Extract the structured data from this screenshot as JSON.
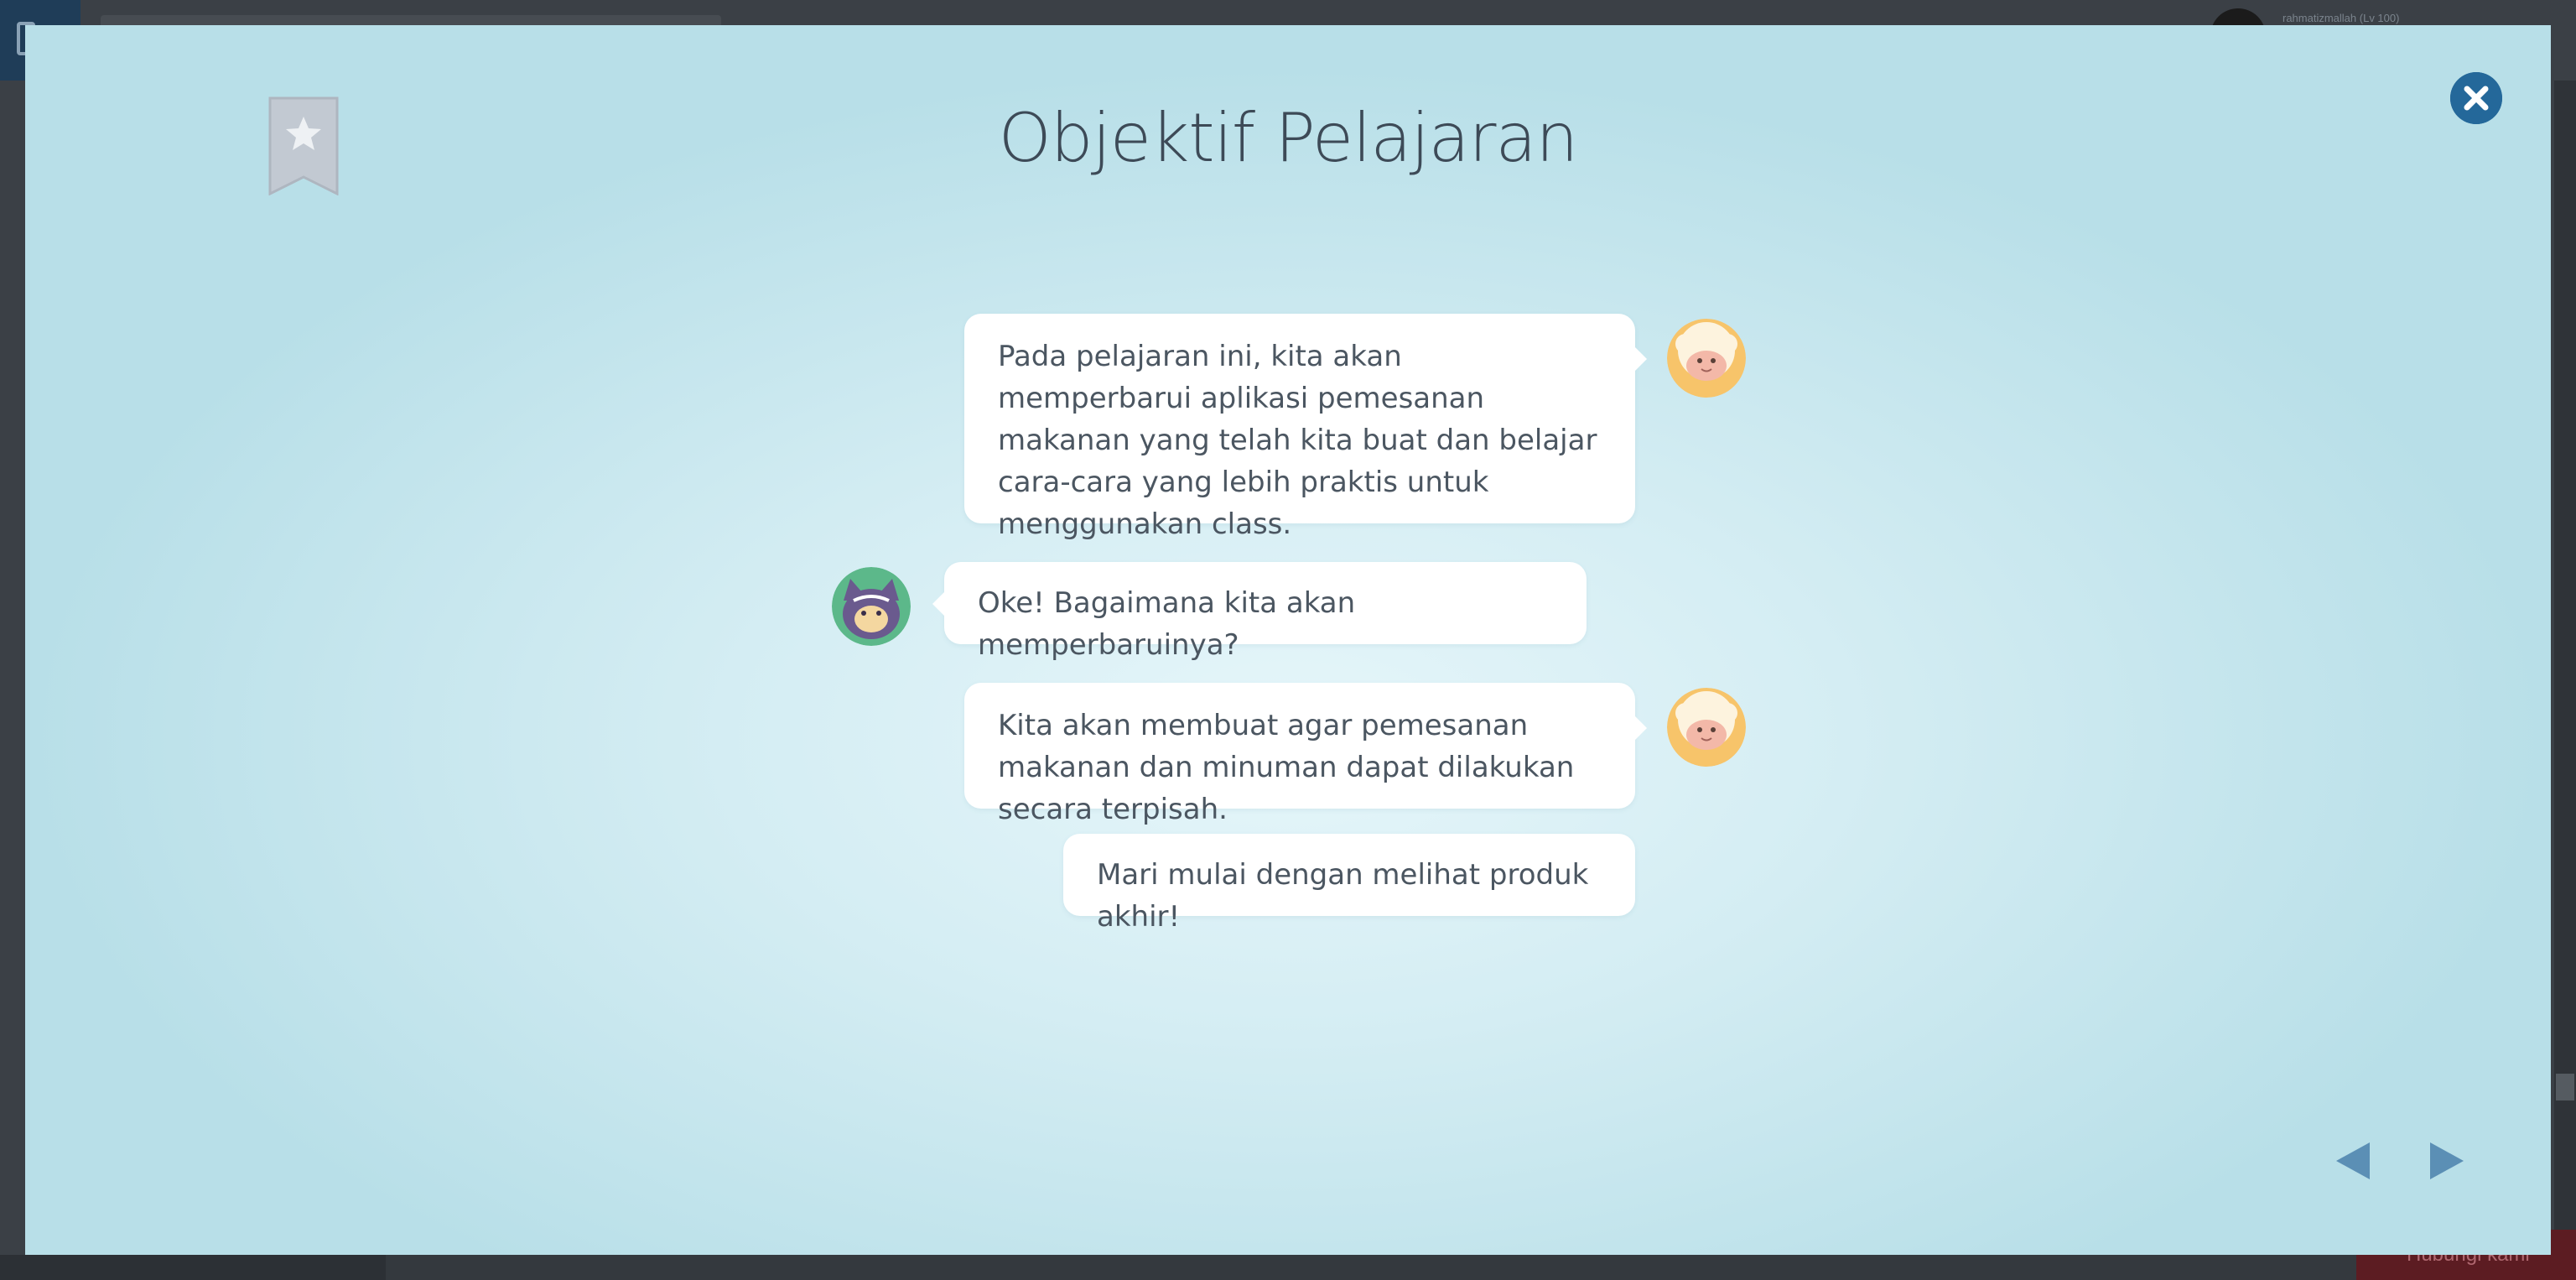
{
  "background_app": {
    "username": "rahmatizmallah (Lv 100)",
    "bottom_button_label": "Hubungi kami"
  },
  "modal": {
    "title": "Objektif Pelajaran",
    "messages": [
      {
        "speaker": "sheep",
        "side": "right",
        "text": "Pada pelajaran ini, kita akan memperbarui aplikasi pemesanan makanan yang telah kita buat dan belajar cara-cara yang lebih praktis untuk menggunakan class."
      },
      {
        "speaker": "ninja-cat",
        "side": "left",
        "text": "Oke! Bagaimana kita akan memperbaruinya?"
      },
      {
        "speaker": "sheep",
        "side": "right",
        "text": "Kita akan membuat agar pemesanan makanan dan minuman dapat dilakukan secara terpisah."
      },
      {
        "speaker": "sheep",
        "side": "right",
        "text": "Mari mulai dengan melihat produk akhir!"
      }
    ],
    "icons": {
      "bookmark": "bookmark-star-icon",
      "close": "close-circle-icon",
      "prev": "triangle-left-icon",
      "next": "triangle-right-icon"
    },
    "colors": {
      "accent": "#24689a",
      "nav_arrow": "#5b8fb5",
      "bookmark": "#c2c9d2",
      "title": "#3d4a57"
    }
  }
}
